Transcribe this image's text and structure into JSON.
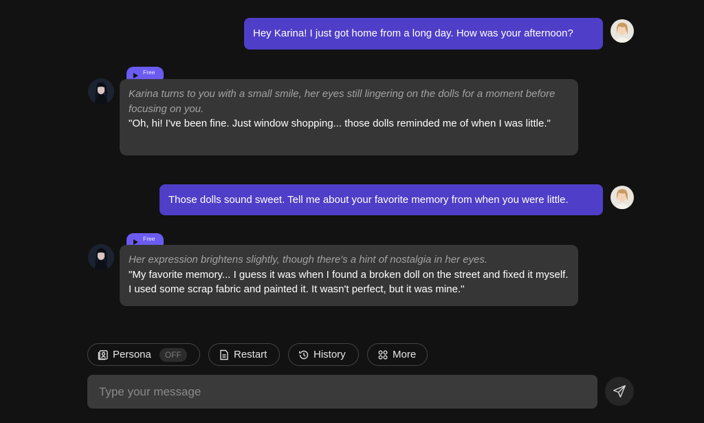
{
  "messages": [
    {
      "role": "user",
      "text": "Hey Karina! I just got home from a long day. How was your afternoon?"
    },
    {
      "role": "bot",
      "badge": "Free",
      "action": "Karina turns to you with a small smile, her eyes still lingering on the dolls for a moment before focusing on you.",
      "speech": "\"Oh, hi! I've been fine. Just window shopping... those dolls reminded me of when I was little.\""
    },
    {
      "role": "user",
      "text": "Those dolls sound sweet. Tell me about your favorite memory from when you were little."
    },
    {
      "role": "bot",
      "badge": "Free",
      "action": "Her expression brightens slightly, though there's a hint of nostalgia in her eyes.",
      "speech": "\"My favorite memory... I guess it was when I found a broken doll on the street and fixed it myself. I used some scrap fabric and painted it. It wasn't perfect, but it was mine.\""
    }
  ],
  "toolbar": {
    "persona_label": "Persona",
    "persona_state": "OFF",
    "restart_label": "Restart",
    "history_label": "History",
    "more_label": "More"
  },
  "composer": {
    "placeholder": "Type your message",
    "send_icon": "paper-plane-icon"
  },
  "colors": {
    "background": "#121212",
    "user_bubble": "#4f3ec7",
    "bot_bubble": "#363636",
    "badge": "#6b5bf0"
  }
}
